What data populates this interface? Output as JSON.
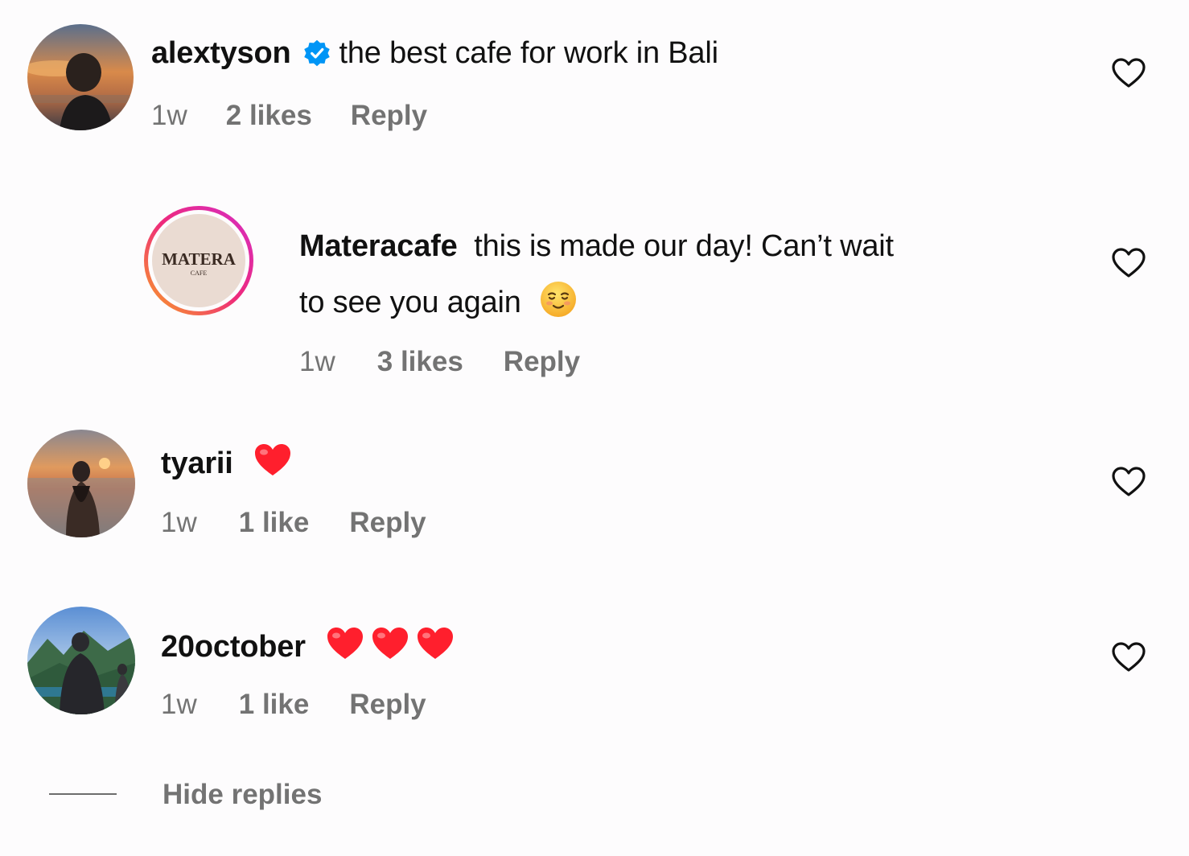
{
  "comments": [
    {
      "username": "alextyson",
      "verified": true,
      "text": "the best cafe for work in Bali",
      "time": "1w",
      "likes": "2 likes",
      "reply": "Reply"
    },
    {
      "username": "Materacafe",
      "text_line1": "this is made our day! Can’t wait",
      "text_line2": "to see you again",
      "emoji": "smiling-face-emoji",
      "avatar_logo": "MATERA",
      "avatar_logo_sub": "CAFE",
      "time": "1w",
      "likes": "3 likes",
      "reply": "Reply"
    },
    {
      "username": "tyarii",
      "emoji": "red-heart-emoji",
      "time": "1w",
      "likes": "1 like",
      "reply": "Reply"
    },
    {
      "username": "20october",
      "emoji_count": 3,
      "time": "1w",
      "likes": "1 like",
      "reply": "Reply"
    }
  ],
  "hide_replies": "Hide replies",
  "colors": {
    "meta_text": "#737373",
    "verified_blue": "#0095f6",
    "heart_red": "#ff1f2d"
  }
}
